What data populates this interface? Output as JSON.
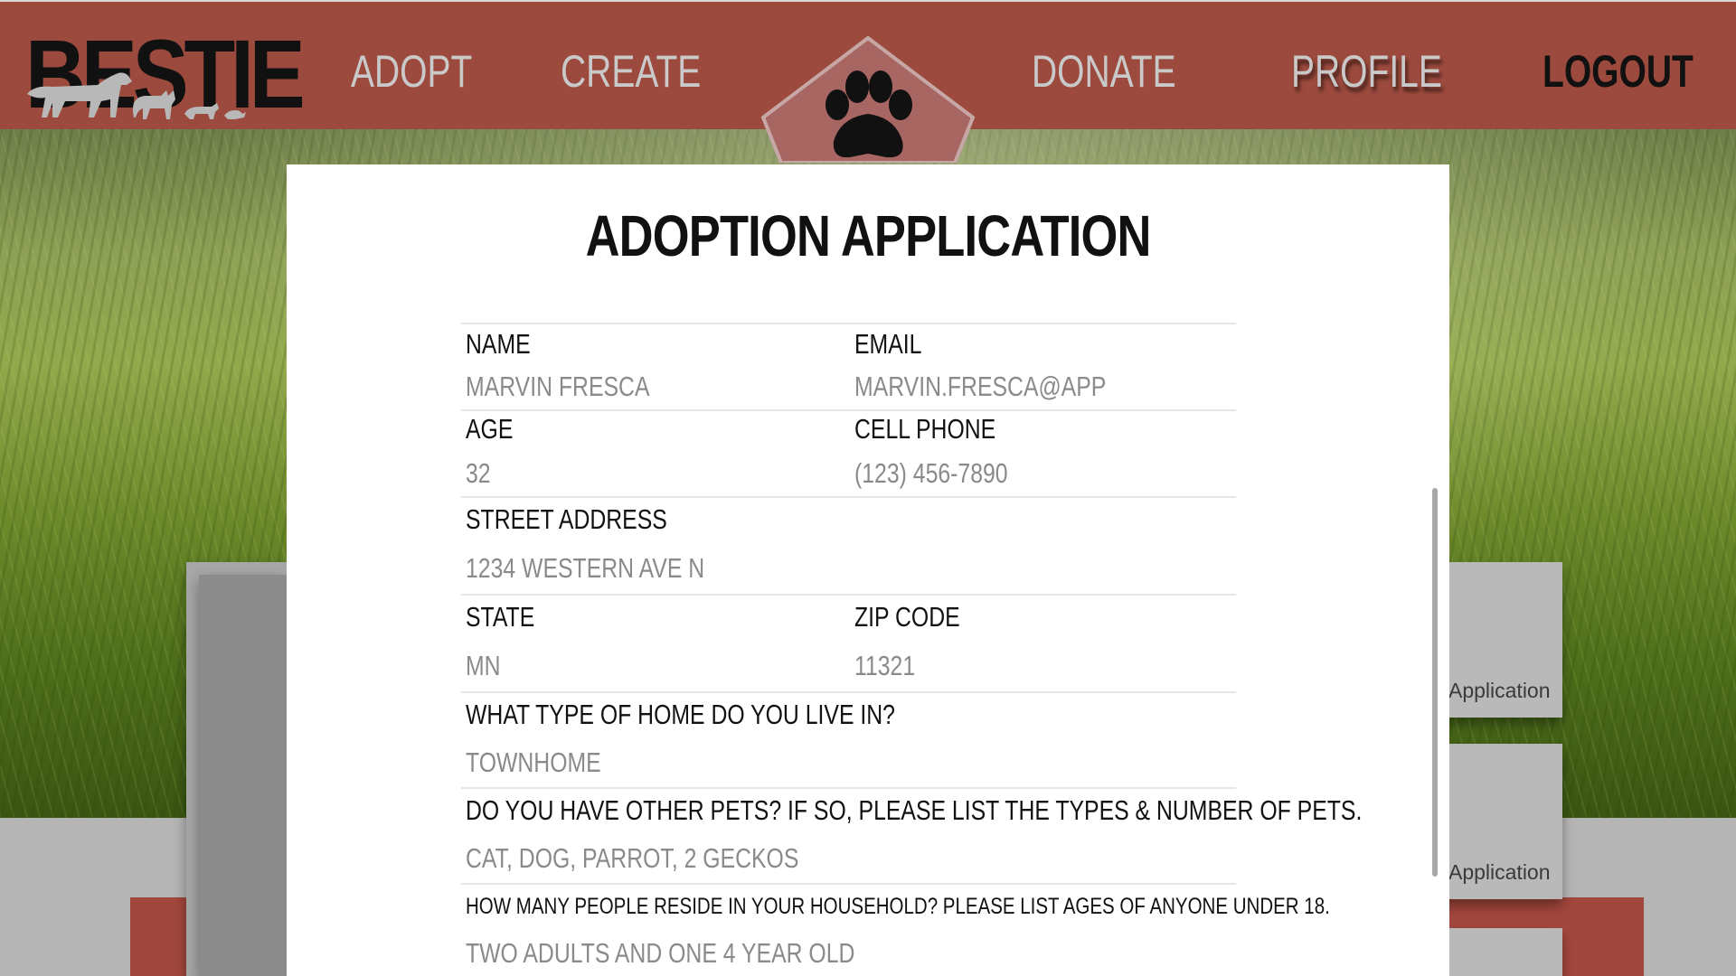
{
  "header": {
    "logo_text": "BESTIE",
    "nav": {
      "adopt": "ADOPT",
      "create": "CREATE",
      "donate": "DONATE",
      "profile": "PROFILE",
      "logout": "LOGOUT"
    },
    "paw_icon": "paw-icon"
  },
  "background_cards": {
    "card1_label": "Application",
    "card2_label": "Application"
  },
  "modal": {
    "title": "ADOPTION APPLICATION",
    "fields": {
      "name": {
        "label": "NAME",
        "value": "MARVIN FRESCA"
      },
      "email": {
        "label": "EMAIL",
        "value": "MARVIN.FRESCA@APP"
      },
      "age": {
        "label": "AGE",
        "value": "32"
      },
      "cell_phone": {
        "label": "CELL PHONE",
        "value": "(123) 456-7890"
      },
      "street_address": {
        "label": "STREET ADDRESS",
        "value": "1234 WESTERN AVE N"
      },
      "state": {
        "label": "STATE",
        "value": "MN"
      },
      "zip_code": {
        "label": "ZIP CODE",
        "value": "11321"
      },
      "home_type": {
        "label": "WHAT TYPE OF HOME DO YOU LIVE IN?",
        "value": "TOWNHOME"
      },
      "other_pets": {
        "label": "DO YOU HAVE OTHER PETS? IF SO, PLEASE LIST THE TYPES & NUMBER OF PETS.",
        "value": "CAT,  DOG, PARROT, 2 GECKOS"
      },
      "household": {
        "label": "HOW MANY PEOPLE RESIDE IN YOUR HOUSEHOLD? PLEASE LIST AGES OF ANYONE UNDER 18.",
        "value": "TWO ADULTS AND ONE 4 YEAR OLD"
      }
    }
  },
  "colors": {
    "header_bg": "#9c4a3d",
    "nav_text": "#c9c9c9",
    "logout_text": "#111111",
    "field_value": "#8a8a8a"
  }
}
